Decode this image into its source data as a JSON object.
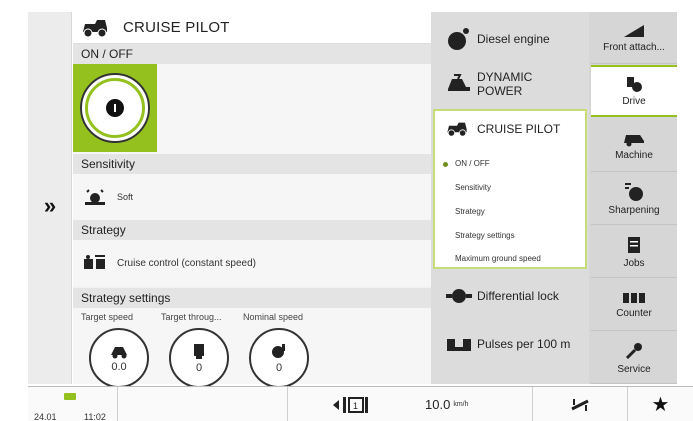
{
  "main": {
    "title": "CRUISE PILOT",
    "onoff_label": "ON / OFF",
    "sensitivity": {
      "header": "Sensitivity",
      "value": "Soft"
    },
    "strategy": {
      "header": "Strategy",
      "value": "Cruise control (constant speed)"
    },
    "strategy_settings": {
      "header": "Strategy settings",
      "gauges": [
        {
          "label": "Target speed",
          "value": "0.0"
        },
        {
          "label": "Target throug...",
          "value": "0"
        },
        {
          "label": "Nominal speed",
          "value": "0"
        }
      ]
    }
  },
  "middle": {
    "items": [
      {
        "label": "Diesel engine"
      },
      {
        "label": "DYNAMIC\nPOWER"
      },
      {
        "label": "Differential lock"
      },
      {
        "label": "Pulses per 100 m"
      }
    ],
    "cruise_pilot": {
      "title": "CRUISE PILOT",
      "subitems": [
        "ON / OFF",
        "Sensitivity",
        "Strategy",
        "Strategy settings",
        "Maximum ground speed"
      ]
    }
  },
  "nav": {
    "items": [
      {
        "label": "Front attach...",
        "icon": "front-attachment-icon"
      },
      {
        "label": "Drive",
        "icon": "drive-icon",
        "active": true
      },
      {
        "label": "Machine",
        "icon": "machine-icon"
      },
      {
        "label": "Sharpening",
        "icon": "sharpening-icon"
      },
      {
        "label": "Jobs",
        "icon": "jobs-icon"
      },
      {
        "label": "Counter",
        "icon": "counter-icon"
      },
      {
        "label": "Service",
        "icon": "wrench-icon"
      }
    ]
  },
  "status": {
    "date": "24.01",
    "time": "11:02",
    "speed": "10.0",
    "speed_unit": "km/h"
  },
  "colors": {
    "accent": "#95c11f",
    "panel": "#f2f2f2",
    "nav": "#d6d6d6"
  }
}
